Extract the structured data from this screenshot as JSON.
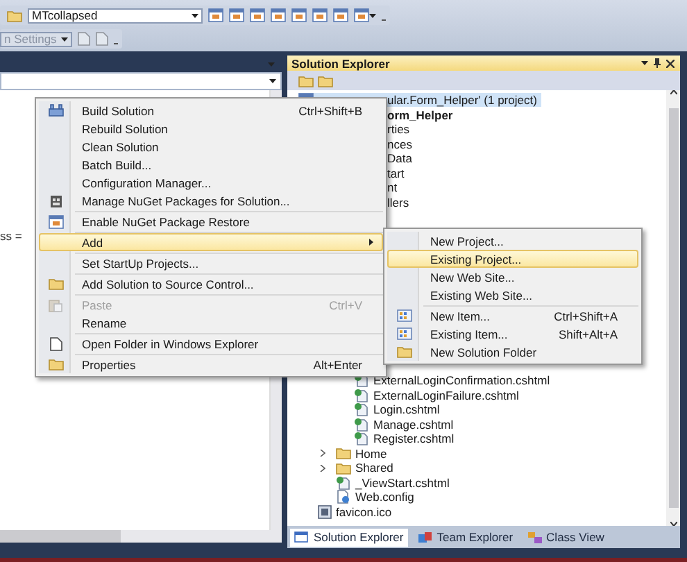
{
  "toolbar": {
    "config_combo": {
      "value": "MTcollapsed"
    },
    "settings_combo": {
      "value": "n Settings",
      "disabled": true
    }
  },
  "editor": {
    "code_fragment": "ss ="
  },
  "solution_explorer": {
    "title": "Solution Explorer",
    "upper_rows": [
      {
        "kind": "solution",
        "label": "ular.Form_Helper' (1 project)",
        "selected": true,
        "bold": false
      },
      {
        "kind": "cut",
        "label": "orm_Helper",
        "selected": false,
        "bold": true
      },
      {
        "kind": "cut",
        "label": "rties",
        "selected": false,
        "bold": false
      },
      {
        "kind": "cut",
        "label": "nces",
        "selected": false,
        "bold": false
      },
      {
        "kind": "cut",
        "label": "Data",
        "selected": false,
        "bold": false
      },
      {
        "kind": "cut",
        "label": "tart",
        "selected": false,
        "bold": false
      },
      {
        "kind": "cut",
        "label": "nt",
        "selected": false,
        "bold": false
      },
      {
        "kind": "cut",
        "label": "llers",
        "selected": false,
        "bold": false
      }
    ],
    "lower_tree": [
      {
        "kind": "group",
        "children": [
          {
            "kind": "group",
            "children": [
              {
                "kind": "file",
                "label": "ExternalLoginConfirmation.cshtml"
              },
              {
                "kind": "file",
                "label": "ExternalLoginFailure.cshtml"
              },
              {
                "kind": "file",
                "label": "Login.cshtml"
              },
              {
                "kind": "file",
                "label": "Manage.cshtml"
              },
              {
                "kind": "file",
                "label": "Register.cshtml"
              }
            ]
          },
          {
            "kind": "folder",
            "label": "Home",
            "expanded": false
          },
          {
            "kind": "folder",
            "label": "Shared",
            "expanded": false
          },
          {
            "kind": "file",
            "label": "_ViewStart.cshtml"
          },
          {
            "kind": "config",
            "label": "Web.config"
          }
        ]
      },
      {
        "kind": "image",
        "label": "favicon.ico"
      }
    ],
    "tabs": [
      {
        "label": "Solution Explorer",
        "selected": true
      },
      {
        "label": "Team Explorer",
        "selected": false
      },
      {
        "label": "Class View",
        "selected": false
      }
    ]
  },
  "context_menu": {
    "items": [
      {
        "kind": "item",
        "label": "Build Solution",
        "shortcut": "Ctrl+Shift+B",
        "has_icon": true,
        "selected": false,
        "disabled": false,
        "has_submenu": false
      },
      {
        "kind": "item",
        "label": "Rebuild Solution",
        "has_icon": false,
        "selected": false,
        "disabled": false,
        "has_submenu": false
      },
      {
        "kind": "item",
        "label": "Clean Solution",
        "has_icon": false,
        "selected": false,
        "disabled": false,
        "has_submenu": false
      },
      {
        "kind": "item",
        "label": "Batch Build...",
        "has_icon": false,
        "selected": false,
        "disabled": false,
        "has_submenu": false
      },
      {
        "kind": "item",
        "label": "Configuration Manager...",
        "has_icon": false,
        "selected": false,
        "disabled": false,
        "has_submenu": false
      },
      {
        "kind": "item",
        "label": "Manage NuGet Packages for Solution...",
        "has_icon": true,
        "selected": false,
        "disabled": false,
        "has_submenu": false
      },
      {
        "kind": "separator"
      },
      {
        "kind": "item",
        "label": "Enable NuGet Package Restore",
        "has_icon": true,
        "selected": false,
        "disabled": false,
        "has_submenu": false
      },
      {
        "kind": "separator"
      },
      {
        "kind": "item",
        "label": "Add",
        "has_icon": false,
        "selected": true,
        "disabled": false,
        "has_submenu": true
      },
      {
        "kind": "separator"
      },
      {
        "kind": "item",
        "label": "Set StartUp Projects...",
        "has_icon": false,
        "selected": false,
        "disabled": false,
        "has_submenu": false
      },
      {
        "kind": "separator"
      },
      {
        "kind": "item",
        "label": "Add Solution to Source Control...",
        "has_icon": true,
        "selected": false,
        "disabled": false,
        "has_submenu": false
      },
      {
        "kind": "separator"
      },
      {
        "kind": "item",
        "label": "Paste",
        "shortcut": "Ctrl+V",
        "has_icon": true,
        "selected": false,
        "disabled": true,
        "has_submenu": false
      },
      {
        "kind": "item",
        "label": "Rename",
        "has_icon": false,
        "selected": false,
        "disabled": false,
        "has_submenu": false
      },
      {
        "kind": "separator"
      },
      {
        "kind": "item",
        "label": "Open Folder in Windows Explorer",
        "has_icon": true,
        "selected": false,
        "disabled": false,
        "has_submenu": false
      },
      {
        "kind": "separator"
      },
      {
        "kind": "item",
        "label": "Properties",
        "shortcut": "Alt+Enter",
        "has_icon": true,
        "selected": false,
        "disabled": false,
        "has_submenu": false
      }
    ]
  },
  "submenu": {
    "items": [
      {
        "kind": "item",
        "label": "New Project...",
        "has_icon": false,
        "selected": false,
        "disabled": false,
        "has_submenu": false
      },
      {
        "kind": "item",
        "label": "Existing Project...",
        "has_icon": false,
        "selected": true,
        "disabled": false,
        "has_submenu": false
      },
      {
        "kind": "item",
        "label": "New Web Site...",
        "has_icon": false,
        "selected": false,
        "disabled": false,
        "has_submenu": false
      },
      {
        "kind": "item",
        "label": "Existing Web Site...",
        "has_icon": false,
        "selected": false,
        "disabled": false,
        "has_submenu": false
      },
      {
        "kind": "separator"
      },
      {
        "kind": "item",
        "label": "New Item...",
        "shortcut": "Ctrl+Shift+A",
        "has_icon": true,
        "selected": false,
        "disabled": false,
        "has_submenu": false
      },
      {
        "kind": "item",
        "label": "Existing Item...",
        "shortcut": "Shift+Alt+A",
        "has_icon": true,
        "selected": false,
        "disabled": false,
        "has_submenu": false
      },
      {
        "kind": "item",
        "label": "New Solution Folder",
        "has_icon": true,
        "selected": false,
        "disabled": false,
        "has_submenu": false
      }
    ]
  }
}
